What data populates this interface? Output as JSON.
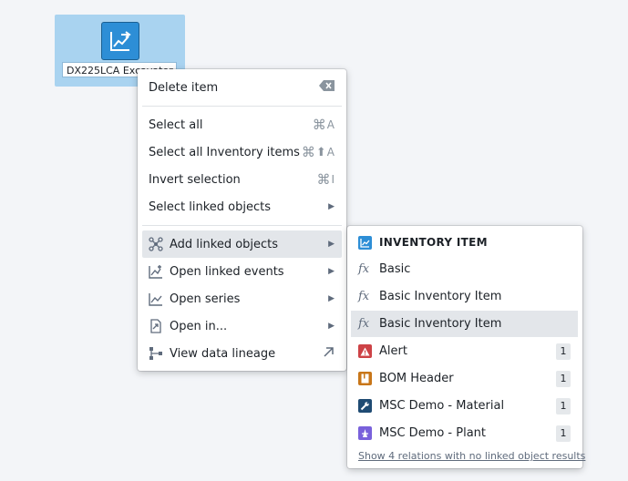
{
  "node": {
    "label": "DX225LCA Excavator",
    "icon": "line-chart-arrow-icon",
    "color": "#2d8ed6"
  },
  "main_menu": {
    "delete_item": {
      "label": "Delete item",
      "icon": "backspace-icon"
    },
    "select_all": {
      "label": "Select all",
      "shortcut_key": "A"
    },
    "select_all_inventory": {
      "label": "Select all Inventory items",
      "shortcut_key": "A"
    },
    "invert_selection": {
      "label": "Invert selection",
      "shortcut_key": "I"
    },
    "select_linked": {
      "label": "Select linked objects"
    },
    "add_linked": {
      "label": "Add linked objects"
    },
    "open_linked_events": {
      "label": "Open linked events"
    },
    "open_series": {
      "label": "Open series"
    },
    "open_in": {
      "label": "Open in..."
    },
    "view_lineage": {
      "label": "View data lineage"
    }
  },
  "sub_menu": {
    "title": "INVENTORY ITEM",
    "functions": [
      {
        "label": "Basic"
      },
      {
        "label": "Basic Inventory Item"
      },
      {
        "label": "Basic Inventory Item"
      }
    ],
    "objects": [
      {
        "label": "Alert",
        "count": "1",
        "color": "#cd4246",
        "icon": "warning-icon"
      },
      {
        "label": "BOM Header",
        "count": "1",
        "color": "#c87619",
        "icon": "book-icon"
      },
      {
        "label": "MSC Demo - Material",
        "count": "1",
        "color": "#1f4b73",
        "icon": "wrench-icon"
      },
      {
        "label": "MSC Demo - Plant",
        "count": "1",
        "color": "#7961db",
        "icon": "plant-icon"
      }
    ],
    "footer": "Show 4 relations with no linked object results"
  }
}
